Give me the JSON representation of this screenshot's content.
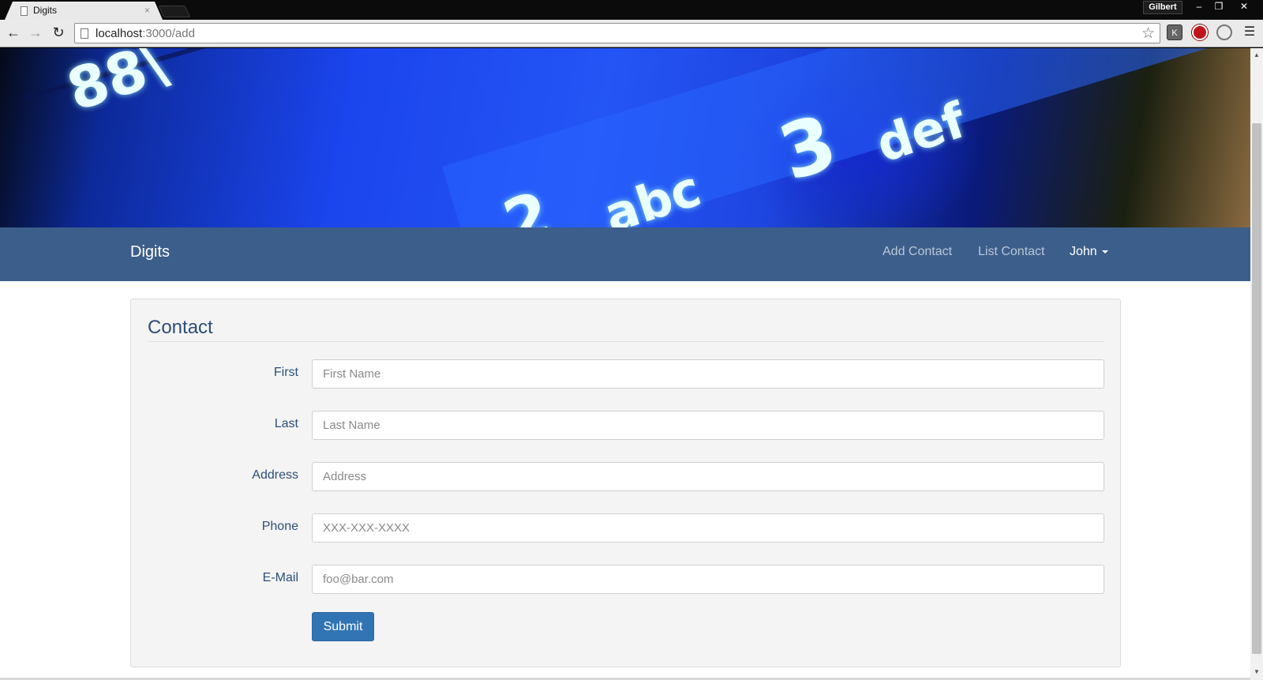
{
  "browser": {
    "tab_title": "Digits",
    "tab_close": "×",
    "profile_name": "Gilbert",
    "window_buttons": [
      "–",
      "❐",
      "✕"
    ],
    "url_host": "localhost",
    "url_path": ":3000/add",
    "icons": {
      "back": "←",
      "forward": "→",
      "reload": "↻",
      "star": "☆",
      "menu": "☰",
      "ext_k": "K"
    }
  },
  "hero": {
    "key_88": "88\\",
    "key_2": "2",
    "key_abc": "abc",
    "key_3": "3",
    "key_def": "def"
  },
  "navbar": {
    "brand": "Digits",
    "links": [
      "Add Contact",
      "List Contact"
    ],
    "user": "John"
  },
  "form": {
    "title": "Contact",
    "fields": [
      {
        "label": "First",
        "placeholder": "First Name"
      },
      {
        "label": "Last",
        "placeholder": "Last Name"
      },
      {
        "label": "Address",
        "placeholder": "Address"
      },
      {
        "label": "Phone",
        "placeholder": "XXX-XXX-XXXX"
      },
      {
        "label": "E-Mail",
        "placeholder": "foo@bar.com"
      }
    ],
    "submit_label": "Submit"
  }
}
